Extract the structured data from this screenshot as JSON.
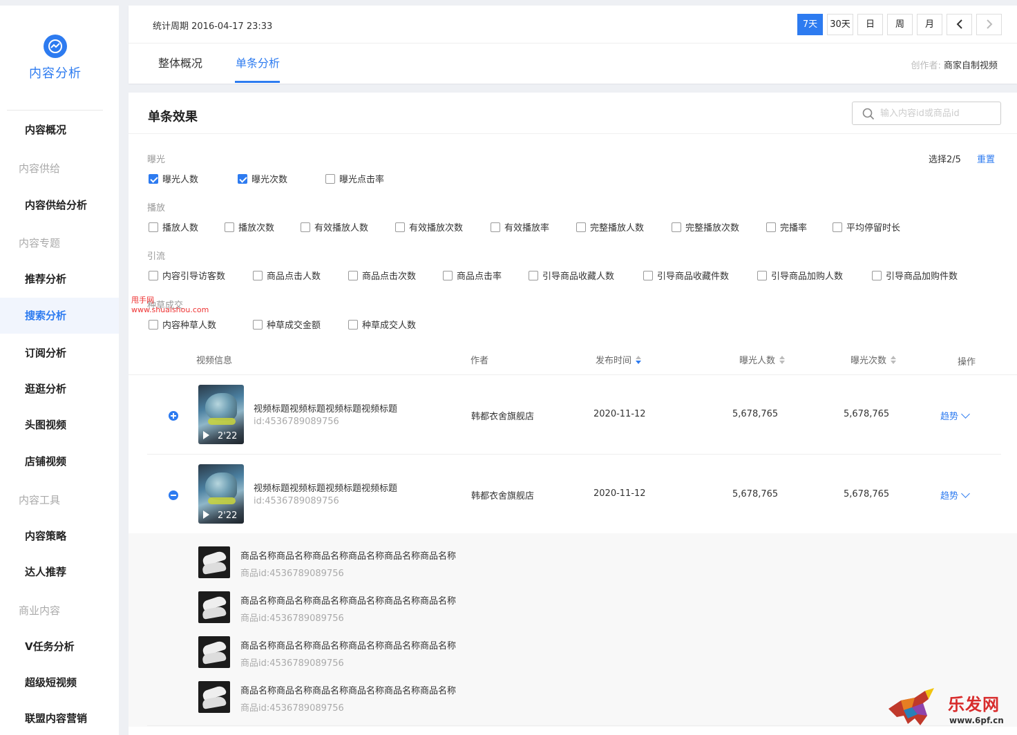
{
  "sidebar": {
    "title": "内容分析",
    "items": [
      {
        "label": "内容概况",
        "type": "item"
      },
      {
        "label": "内容供给",
        "type": "group"
      },
      {
        "label": "内容供给分析",
        "type": "item"
      },
      {
        "label": "内容专题",
        "type": "group"
      },
      {
        "label": "推荐分析",
        "type": "item"
      },
      {
        "label": "搜索分析",
        "type": "item",
        "active": true
      },
      {
        "label": "订阅分析",
        "type": "item"
      },
      {
        "label": "逛逛分析",
        "type": "item"
      },
      {
        "label": "头图视频",
        "type": "item"
      },
      {
        "label": "店铺视频",
        "type": "item"
      },
      {
        "label": "内容工具",
        "type": "group"
      },
      {
        "label": "内容策略",
        "type": "item"
      },
      {
        "label": "达人推荐",
        "type": "item"
      },
      {
        "label": "商业内容",
        "type": "group"
      },
      {
        "label": "V任务分析",
        "type": "item"
      },
      {
        "label": "超级短视频",
        "type": "item"
      },
      {
        "label": "联盟内容营销",
        "type": "item"
      }
    ]
  },
  "header": {
    "period": "统计周期 2016-04-17 23:33",
    "ranges": [
      "7天",
      "30天",
      "日",
      "周",
      "月"
    ],
    "active_range": "7天",
    "tabs": [
      "整体概况",
      "单条分析"
    ],
    "active_tab": "单条分析",
    "creator_label": "创作者:",
    "creator_value": "商家自制视频"
  },
  "main": {
    "title": "单条效果",
    "search_placeholder": "输入内容id或商品id",
    "select_info": "选择2/5",
    "reset": "重置",
    "groups": [
      {
        "label": "曝光",
        "options": [
          {
            "label": "曝光人数",
            "checked": true
          },
          {
            "label": "曝光次数",
            "checked": true
          },
          {
            "label": "曝光点击率",
            "checked": false
          }
        ]
      },
      {
        "label": "播放",
        "options": [
          {
            "label": "播放人数",
            "checked": false
          },
          {
            "label": "播放次数",
            "checked": false
          },
          {
            "label": "有效播放人数",
            "checked": false
          },
          {
            "label": "有效播放次数",
            "checked": false
          },
          {
            "label": "有效播放率",
            "checked": false
          },
          {
            "label": "完整播放人数",
            "checked": false
          },
          {
            "label": "完整播放次数",
            "checked": false
          },
          {
            "label": "完播率",
            "checked": false
          },
          {
            "label": "平均停留时长",
            "checked": false
          }
        ]
      },
      {
        "label": "引流",
        "options": [
          {
            "label": "内容引导访客数",
            "checked": false
          },
          {
            "label": "商品点击人数",
            "checked": false
          },
          {
            "label": "商品点击次数",
            "checked": false
          },
          {
            "label": "商品点击率",
            "checked": false
          },
          {
            "label": "引导商品收藏人数",
            "checked": false
          },
          {
            "label": "引导商品收藏件数",
            "checked": false
          },
          {
            "label": "引导商品加购人数",
            "checked": false
          },
          {
            "label": "引导商品加购件数",
            "checked": false
          }
        ]
      },
      {
        "label": "种草成交",
        "options": [
          {
            "label": "内容种草人数",
            "checked": false
          },
          {
            "label": "种草成交金额",
            "checked": false
          },
          {
            "label": "种草成交人数",
            "checked": false
          }
        ]
      }
    ],
    "watermark": {
      "line1": "甩手网",
      "line2": "www.shuaishou.com"
    }
  },
  "table": {
    "columns": [
      "视频信息",
      "作者",
      "发布时间",
      "曝光人数",
      "曝光次数",
      "操作"
    ],
    "rows": [
      {
        "title": "视频标题视频标题视频标题视频标题",
        "id": "id:4536789089756",
        "duration": "2'22",
        "author": "韩都衣舍旗舰店",
        "date": "2020-11-12",
        "exposure_users": "5,678,765",
        "exposure_times": "5,678,765",
        "action": "趋势",
        "expanded": false
      },
      {
        "title": "视频标题视频标题视频标题视频标题",
        "id": "id:4536789089756",
        "duration": "2'22",
        "author": "韩都衣舍旗舰店",
        "date": "2020-11-12",
        "exposure_users": "5,678,765",
        "exposure_times": "5,678,765",
        "action": "趋势",
        "expanded": true
      }
    ],
    "goods": [
      {
        "name": "商品名称商品名称商品名称商品名称商品名称商品名称",
        "id": "商品id:4536789089756"
      },
      {
        "name": "商品名称商品名称商品名称商品名称商品名称商品名称",
        "id": "商品id:4536789089756"
      },
      {
        "name": "商品名称商品名称商品名称商品名称商品名称商品名称",
        "id": "商品id:4536789089756"
      },
      {
        "name": "商品名称商品名称商品名称商品名称商品名称商品名称",
        "id": "商品id:4536789089756"
      }
    ]
  },
  "brand_watermark": {
    "text": "乐发网",
    "url": "www.6pf.cn"
  },
  "colors": {
    "accent": "#2d7bf0",
    "background": "#eef0f4"
  }
}
